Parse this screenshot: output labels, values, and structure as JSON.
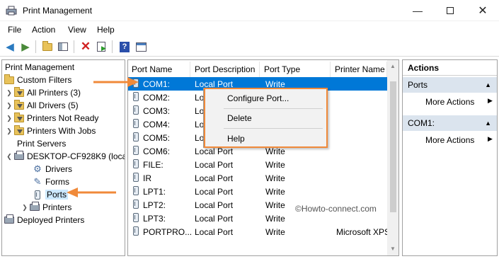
{
  "window": {
    "title": "Print Management"
  },
  "menu": [
    "File",
    "Action",
    "View",
    "Help"
  ],
  "tree": {
    "root": "Print Management",
    "items": [
      {
        "label": "Custom Filters"
      },
      {
        "label": "All Printers (3)"
      },
      {
        "label": "All Drivers (5)"
      },
      {
        "label": "Printers Not Ready"
      },
      {
        "label": "Printers With Jobs"
      },
      {
        "label": "Print Servers"
      },
      {
        "label": "DESKTOP-CF928K9 (loca"
      },
      {
        "label": "Drivers"
      },
      {
        "label": "Forms"
      },
      {
        "label": "Ports"
      },
      {
        "label": "Printers"
      },
      {
        "label": "Deployed Printers"
      }
    ]
  },
  "list": {
    "columns": [
      "Port Name",
      "Port Description",
      "Port Type",
      "Printer Name"
    ],
    "rows": [
      {
        "name": "COM1:",
        "desc": "Local Port",
        "type": "Write",
        "printer": ""
      },
      {
        "name": "COM2:",
        "desc": "Local",
        "type": "",
        "printer": ""
      },
      {
        "name": "COM3:",
        "desc": "Local",
        "type": "",
        "printer": ""
      },
      {
        "name": "COM4:",
        "desc": "Local",
        "type": "",
        "printer": ""
      },
      {
        "name": "COM5:",
        "desc": "Local",
        "type": "",
        "printer": ""
      },
      {
        "name": "COM6:",
        "desc": "Local Port",
        "type": "Write",
        "printer": ""
      },
      {
        "name": "FILE:",
        "desc": "Local Port",
        "type": "Write",
        "printer": ""
      },
      {
        "name": "IR",
        "desc": "Local Port",
        "type": "Write",
        "printer": ""
      },
      {
        "name": "LPT1:",
        "desc": "Local Port",
        "type": "Write",
        "printer": ""
      },
      {
        "name": "LPT2:",
        "desc": "Local Port",
        "type": "Write",
        "printer": ""
      },
      {
        "name": "LPT3:",
        "desc": "Local Port",
        "type": "Write",
        "printer": ""
      },
      {
        "name": "PORTPRO...",
        "desc": "Local Port",
        "type": "Write",
        "printer": "Microsoft XPS"
      }
    ]
  },
  "context_menu": {
    "items": [
      "Configure Port...",
      "Delete",
      "Help"
    ]
  },
  "actions": {
    "title": "Actions",
    "sections": [
      {
        "title": "Ports",
        "item": "More Actions"
      },
      {
        "title": "COM1:",
        "item": "More Actions"
      }
    ]
  },
  "watermark": "©Howto-connect.com",
  "colors": {
    "selection": "#0078d7",
    "annotation": "#f08a3a",
    "section_header": "#dbe4ee"
  }
}
